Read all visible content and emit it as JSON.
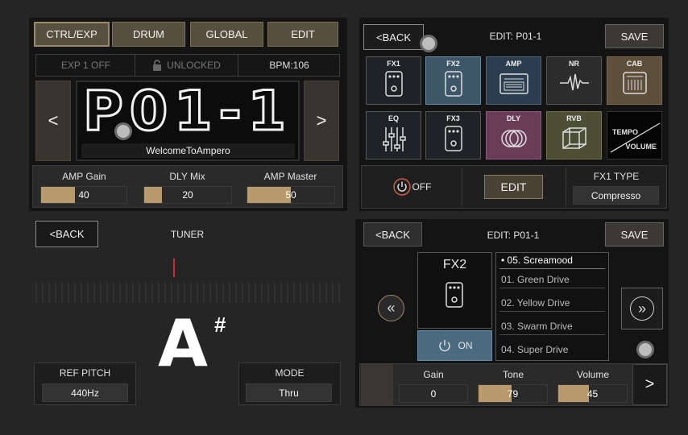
{
  "panel1": {
    "tabs": [
      "CTRL/EXP",
      "DRUM",
      "GLOBAL",
      "EDIT"
    ],
    "exp": "EXP 1 OFF",
    "lock": "UNLOCKED",
    "bpm": "BPM:106",
    "preset": "P01-1",
    "preset_name": "WelcomeToAmpero",
    "prev": "<",
    "next": ">",
    "params": [
      {
        "label": "AMP Gain",
        "value": "40",
        "level": 0.4
      },
      {
        "label": "DLY Mix",
        "value": "20",
        "level": 0.2
      },
      {
        "label": "AMP Master",
        "value": "50",
        "level": 0.5
      }
    ]
  },
  "panel2": {
    "back": "<BACK",
    "title": "EDIT: P01-1",
    "save": "SAVE",
    "fx_row1": [
      "FX1",
      "FX2",
      "AMP",
      "NR",
      "CAB"
    ],
    "fx_row2": [
      "EQ",
      "FX3",
      "DLY",
      "RVB"
    ],
    "tempo_top": "TEMPO",
    "tempo_bottom": "VOLUME",
    "off": "OFF",
    "edit": "EDIT",
    "fx_type_label": "FX1 TYPE",
    "fx_type_value": "Compresso"
  },
  "panel3": {
    "back": "<BACK",
    "title": "TUNER",
    "note": "A",
    "accidental": "#",
    "ref_label": "REF PITCH",
    "ref_value": "440Hz",
    "mode_label": "MODE",
    "mode_value": "Thru"
  },
  "panel4": {
    "back": "<BACK",
    "title": "EDIT: P01-1",
    "save": "SAVE",
    "fx_name": "FX2",
    "on": "ON",
    "list": [
      "• 05. Screamood",
      "01. Green Drive",
      "02. Yellow Drive",
      "03. Swarm Drive",
      "04. Super Drive"
    ],
    "params": [
      {
        "label": "Gain",
        "value": "0",
        "level": 0
      },
      {
        "label": "Tone",
        "value": "79",
        "level": 0.48
      },
      {
        "label": "Volume",
        "value": "45",
        "level": 0.45
      }
    ],
    "next": ">"
  }
}
